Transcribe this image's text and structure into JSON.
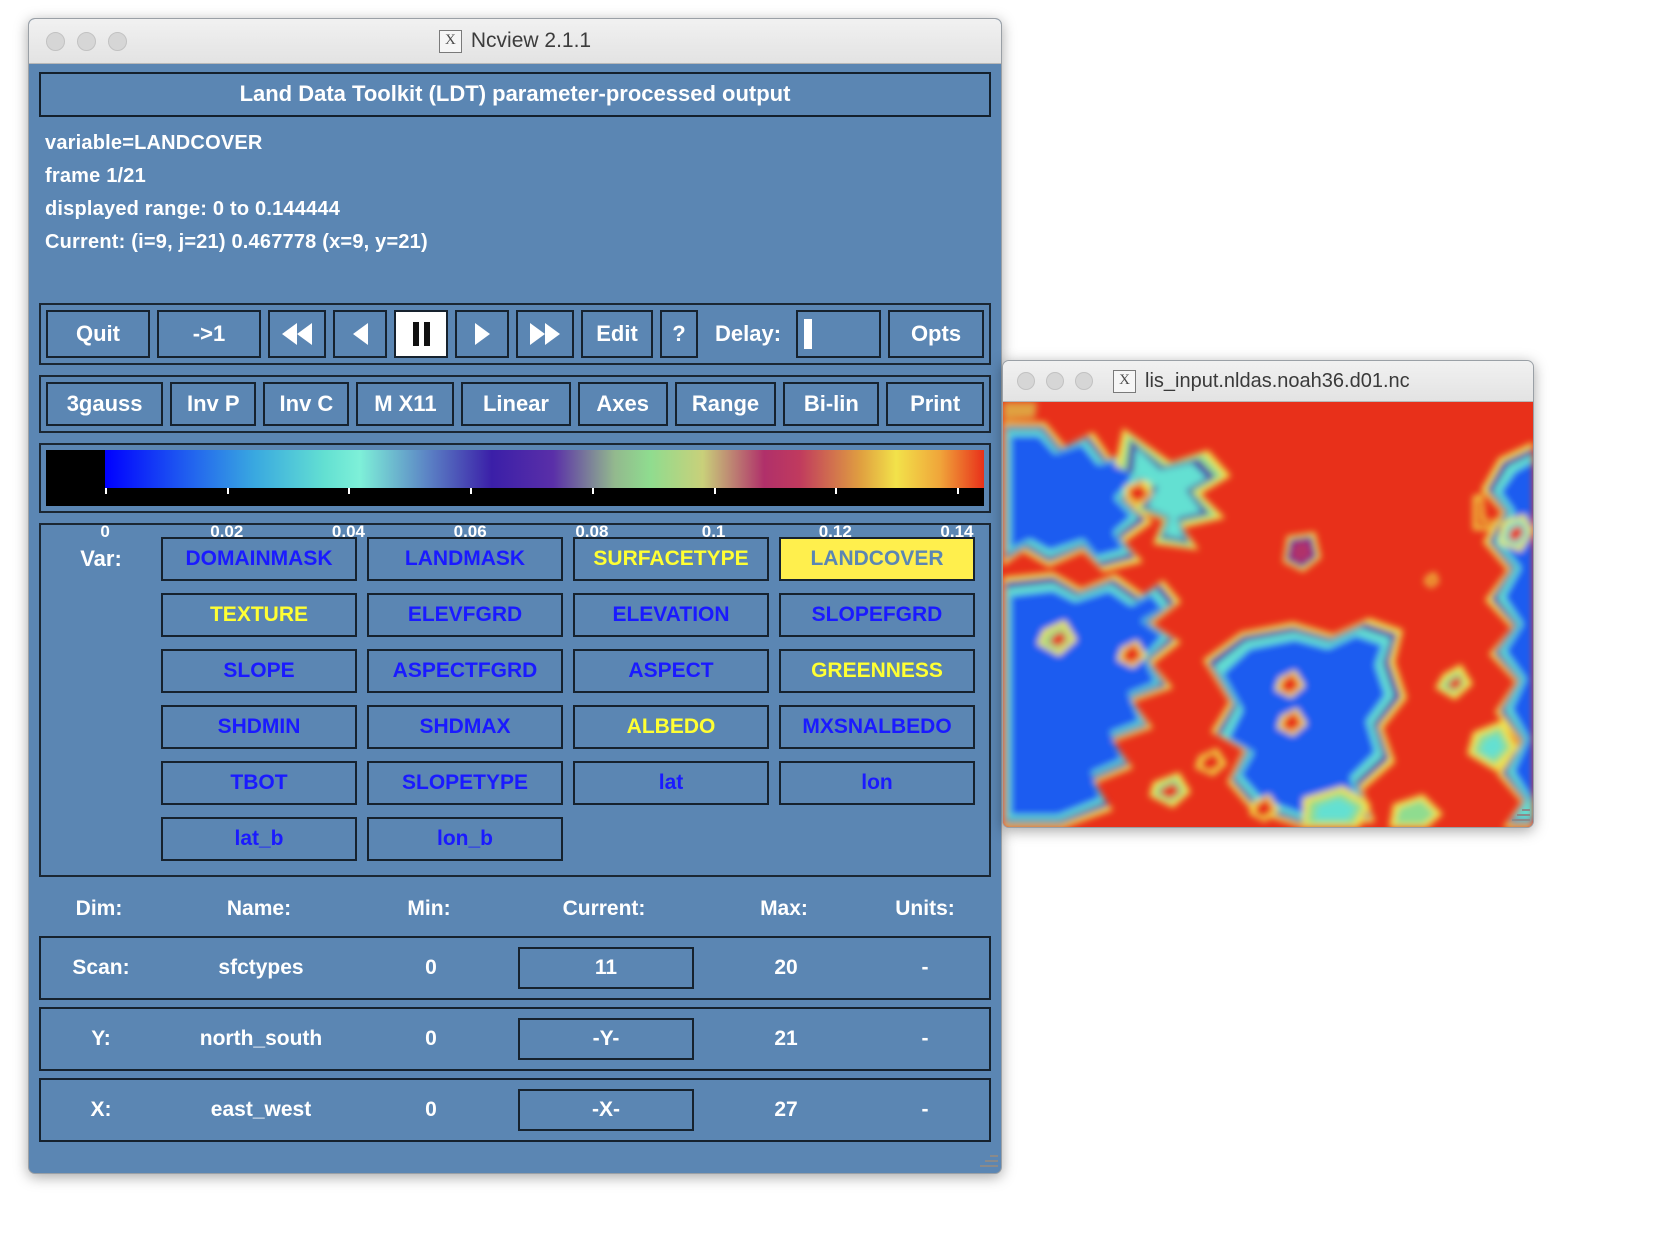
{
  "main_window": {
    "title": "Ncview 2.1.1",
    "title_icon": "x-window-icon",
    "banner": "Land Data Toolkit (LDT) parameter-processed output",
    "info": {
      "variable": "variable=LANDCOVER",
      "frame": "frame 1/21",
      "displayed_range": "displayed range: 0 to 0.144444",
      "current": "Current: (i=9, j=21) 0.467778 (x=9, y=21)"
    },
    "controls": {
      "quit": "Quit",
      "to_one": "->1",
      "rewind_fast": "◀◀",
      "step_back": "◀",
      "pause": "‖",
      "step_forward": "▶",
      "forward_fast": "▶▶",
      "edit": "Edit",
      "help": "?",
      "delay_label": "Delay:",
      "delay_value": "",
      "opts": "Opts"
    },
    "options_row": [
      "3gauss",
      "Inv P",
      "Inv C",
      "M X11",
      "Linear",
      "Axes",
      "Range",
      "Bi-lin",
      "Print"
    ],
    "colorbar": {
      "tick_labels": [
        "0",
        "0.02",
        "0.04",
        "0.06",
        "0.08",
        "0.1",
        "0.12",
        "0.14"
      ],
      "tick_values": [
        0,
        0.02,
        0.04,
        0.06,
        0.08,
        0.1,
        0.12,
        0.14
      ],
      "min": 0,
      "max": 0.144444,
      "null_color": "#000000"
    },
    "var_section": {
      "label": "Var:",
      "selected": "LANDCOVER",
      "highlight_bg": "#ffef4d",
      "yellow_text_color": "#ffff33",
      "blue_text_color": "#1a1aff",
      "rows": [
        [
          {
            "label": "DOMAINMASK",
            "style": "blue"
          },
          {
            "label": "LANDMASK",
            "style": "blue"
          },
          {
            "label": "SURFACETYPE",
            "style": "yellow"
          },
          {
            "label": "LANDCOVER",
            "style": "selected"
          }
        ],
        [
          {
            "label": "TEXTURE",
            "style": "yellow"
          },
          {
            "label": "ELEVFGRD",
            "style": "blue"
          },
          {
            "label": "ELEVATION",
            "style": "blue"
          },
          {
            "label": "SLOPEFGRD",
            "style": "blue"
          }
        ],
        [
          {
            "label": "SLOPE",
            "style": "blue"
          },
          {
            "label": "ASPECTFGRD",
            "style": "blue"
          },
          {
            "label": "ASPECT",
            "style": "blue"
          },
          {
            "label": "GREENNESS",
            "style": "yellow"
          }
        ],
        [
          {
            "label": "SHDMIN",
            "style": "blue"
          },
          {
            "label": "SHDMAX",
            "style": "blue"
          },
          {
            "label": "ALBEDO",
            "style": "yellow"
          },
          {
            "label": "MXSNALBEDO",
            "style": "blue"
          }
        ],
        [
          {
            "label": "TBOT",
            "style": "blue"
          },
          {
            "label": "SLOPETYPE",
            "style": "blue"
          },
          {
            "label": "lat",
            "style": "blue"
          },
          {
            "label": "lon",
            "style": "blue"
          }
        ],
        [
          {
            "label": "lat_b",
            "style": "blue"
          },
          {
            "label": "lon_b",
            "style": "blue"
          }
        ]
      ]
    },
    "dim_table": {
      "headers": {
        "dim": "Dim:",
        "name": "Name:",
        "min": "Min:",
        "current": "Current:",
        "max": "Max:",
        "units": "Units:"
      },
      "rows": [
        {
          "dim": "Scan:",
          "name": "sfctypes",
          "min": "0",
          "current": "11",
          "max": "20",
          "units": "-"
        },
        {
          "dim": "Y:",
          "name": "north_south",
          "min": "0",
          "current": "-Y-",
          "max": "21",
          "units": "-"
        },
        {
          "dim": "X:",
          "name": "east_west",
          "min": "0",
          "current": "-X-",
          "max": "27",
          "units": "-"
        }
      ]
    }
  },
  "image_window": {
    "title": "lis_input.nldas.noah36.d01.nc",
    "title_icon": "x-window-icon"
  }
}
